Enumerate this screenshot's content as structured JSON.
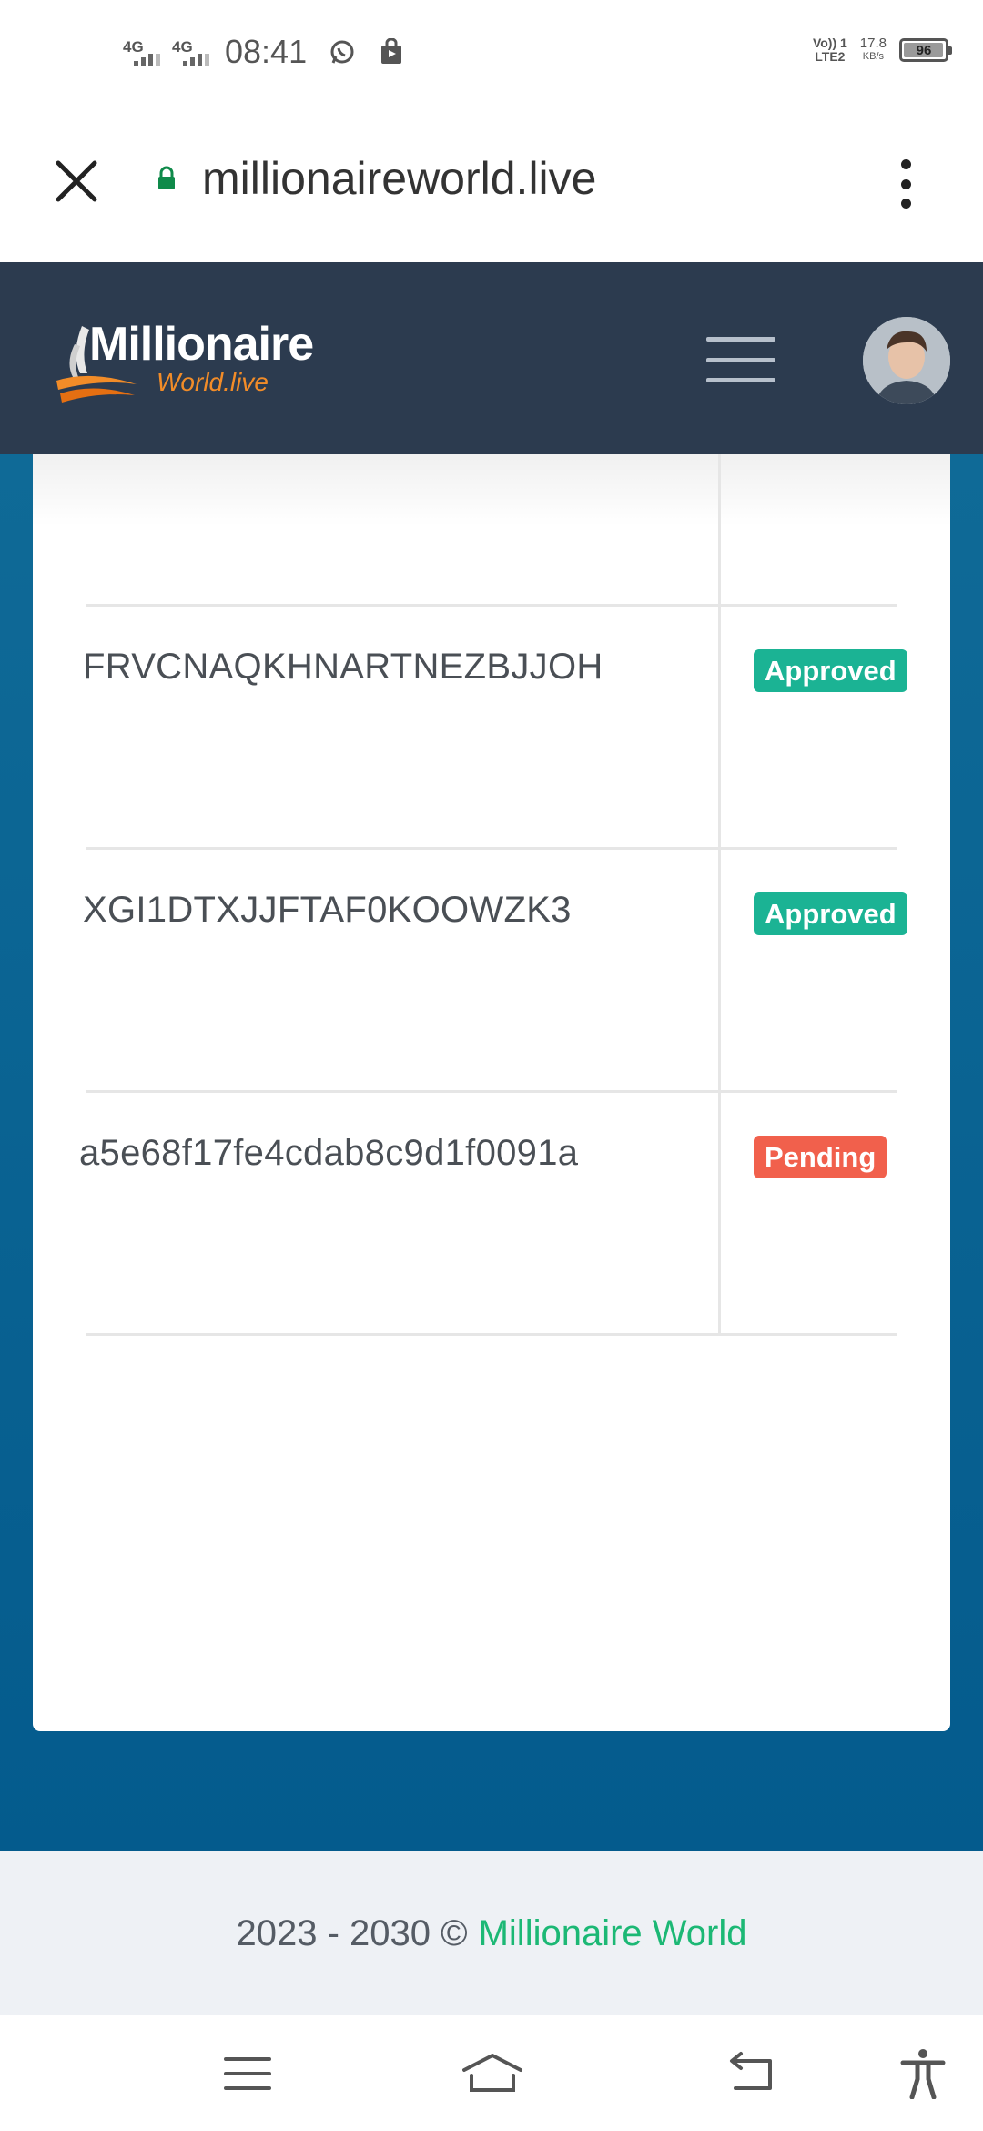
{
  "status_bar": {
    "net1": "4G",
    "net2": "4G",
    "time": "08:41",
    "volte_line1": "Vo)) 1",
    "volte_line2": "LTE2",
    "speed_value": "17.8",
    "speed_unit": "KB/s",
    "battery": "96",
    "icons": [
      "whatsapp-icon",
      "store-bag-icon"
    ]
  },
  "browser": {
    "url": "millionaireworld.live",
    "icons": [
      "close-icon",
      "lock-icon",
      "more-vert-icon"
    ]
  },
  "header": {
    "logo_title": "Millionaire",
    "logo_sub": "World.live",
    "icons": [
      "menu-icon",
      "avatar"
    ]
  },
  "table": {
    "rows": [
      {
        "text": "",
        "status": ""
      },
      {
        "text": "FRVCNAQKHNARTNEZBJJOH",
        "status": "Approved"
      },
      {
        "text": "XGI1DTXJJFTAF0KOOWZK3",
        "status": "Approved"
      },
      {
        "text": "a5e68f17fe4cdab8c9d1f0091a",
        "status": "Pending"
      }
    ]
  },
  "footer": {
    "years": "2023 - 2030 ©",
    "brand": "Millionaire World"
  },
  "colors": {
    "header_bg": "#2c3b4f",
    "main_bg": "#0a6292",
    "approved": "#1bb394",
    "pending": "#f1604c",
    "brand_green": "#1cb875",
    "logo_orange": "#f28c28"
  },
  "navbar": {
    "icons": [
      "recent-apps-icon",
      "home-icon",
      "back-icon",
      "accessibility-icon"
    ]
  }
}
